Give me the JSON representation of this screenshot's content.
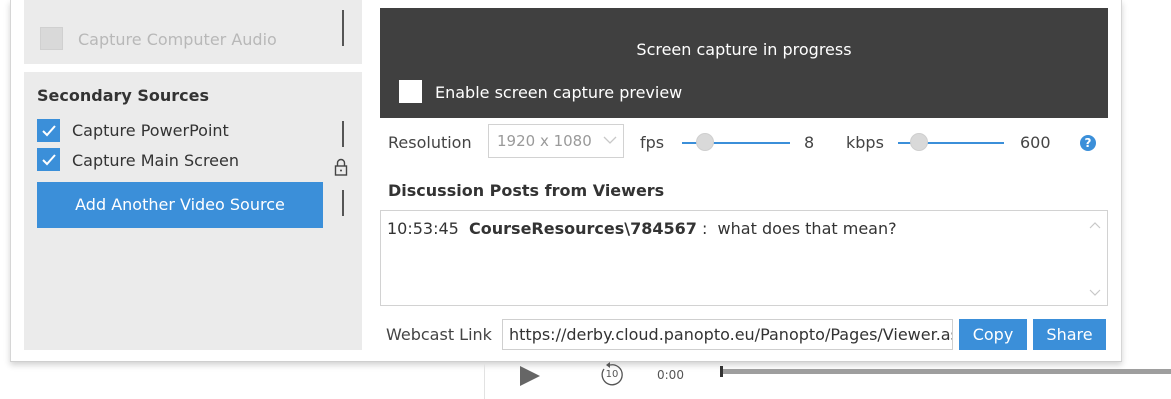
{
  "sources": {
    "capture_audio_label": "Capture Computer Audio",
    "secondary_title": "Secondary Sources",
    "items": [
      {
        "label": "Capture PowerPoint",
        "checked": true
      },
      {
        "label": "Capture Main Screen",
        "checked": true
      }
    ],
    "add_button": "Add Another Video Source"
  },
  "preview": {
    "status": "Screen capture in progress",
    "enable_label": "Enable screen capture preview"
  },
  "settings": {
    "resolution_label": "Resolution",
    "resolution_value": "1920 x 1080",
    "fps_label": "fps",
    "fps_value": "8",
    "kbps_label": "kbps",
    "kbps_value": "600",
    "help": "?"
  },
  "discussion": {
    "title": "Discussion Posts from Viewers",
    "posts": [
      {
        "time": "10:53:45",
        "user": "CourseResources\\784567",
        "sep": " :",
        "message": "what does that mean?"
      }
    ]
  },
  "webcast": {
    "label": "Webcast Link",
    "url": "https://derby.cloud.panopto.eu/Panopto/Pages/Viewer.aspx",
    "copy": "Copy",
    "share": "Share"
  },
  "player": {
    "skip": "10",
    "time": "0:00"
  },
  "colors": {
    "accent": "#3b8fd9",
    "dark_panel": "#404040",
    "panel_bg": "#ebebeb"
  }
}
